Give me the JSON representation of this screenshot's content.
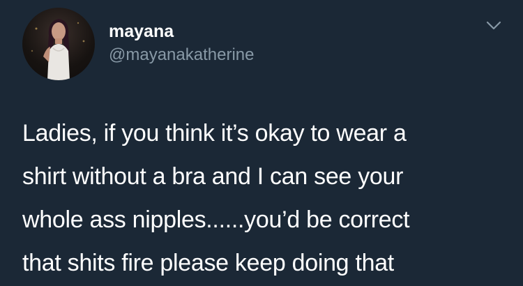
{
  "user": {
    "display_name": "mayana",
    "handle": "@mayanakatherine",
    "avatar_icon": "profile-photo"
  },
  "menu": {
    "icon": "chevron-down-icon"
  },
  "tweet": {
    "lines": [
      "Ladies, if you think it’s okay to wear a",
      "shirt without a bra and I can see your",
      "whole ass nipples......you’d be correct",
      "that shits fire please keep doing that"
    ]
  },
  "colors": {
    "background": "#1b2836",
    "text": "#ffffff",
    "handle": "#8899a6"
  }
}
